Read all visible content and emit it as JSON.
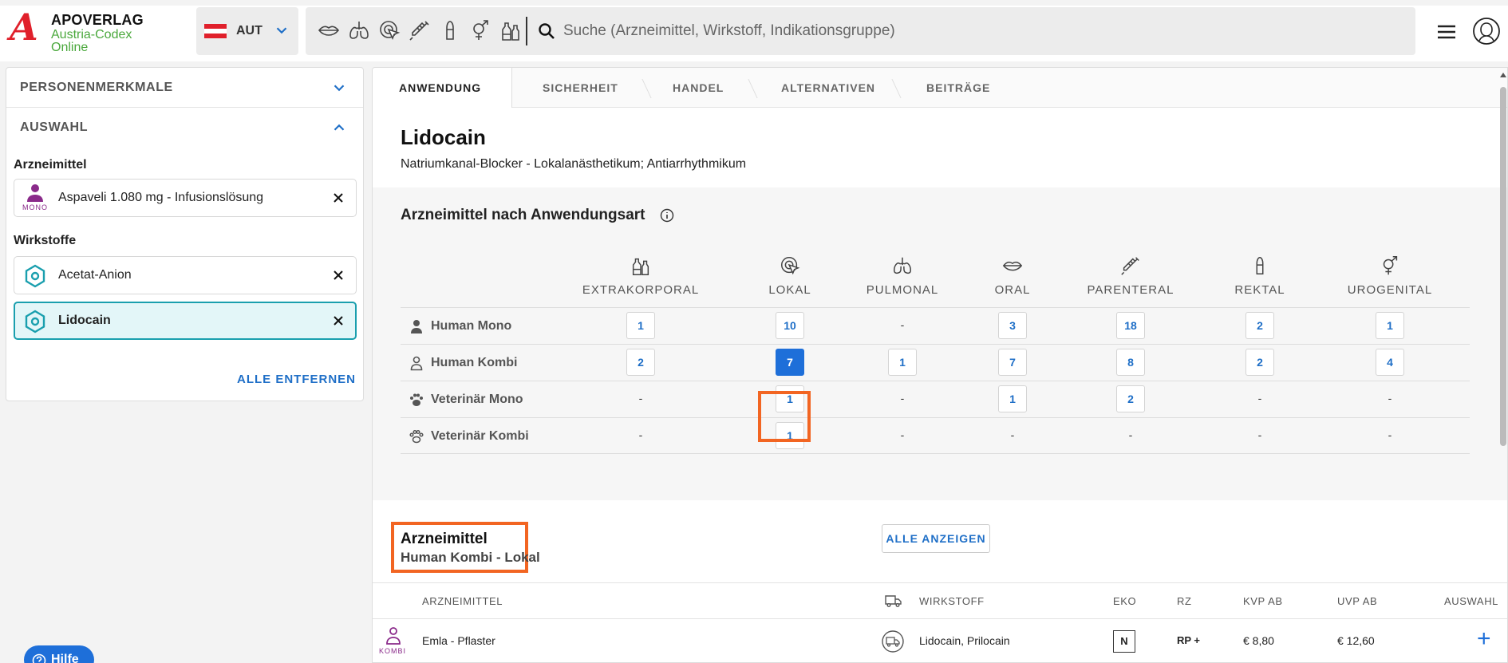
{
  "header": {
    "logo_title": "APOVERLAG",
    "logo_sub1": "Austria-Codex",
    "logo_sub2": "Online",
    "country_code": "AUT",
    "search_placeholder": "Suche (Arzneimittel, Wirkstoff, Indikationsgruppe)"
  },
  "sidebar": {
    "accordion_personen": "PERSONENMERKMALE",
    "accordion_auswahl": "AUSWAHL",
    "section_arzneimittel": "Arzneimittel",
    "drug_chip": "Aspaveli 1.080 mg - Infusionslösung",
    "drug_chip_tag": "MONO",
    "section_wirkstoffe": "Wirkstoffe",
    "substances": [
      "Acetat-Anion",
      "Lidocain"
    ],
    "remove_all": "ALLE ENTFERNEN"
  },
  "tabs": [
    "ANWENDUNG",
    "SICHERHEIT",
    "HANDEL",
    "ALTERNATIVEN",
    "BEITRÄGE"
  ],
  "main": {
    "title": "Lidocain",
    "subtitle": "Natriumkanal-Blocker - Lokalanästhetikum; Antiarrhythmikum",
    "usage_title": "Arzneimittel nach Anwendungsart",
    "columns": [
      "EXTRAKORPORAL",
      "LOKAL",
      "PULMONAL",
      "ORAL",
      "PARENTERAL",
      "REKTAL",
      "UROGENITAL"
    ],
    "rows": [
      {
        "label": "Human Mono",
        "values": [
          "1",
          "10",
          "-",
          "3",
          "18",
          "2",
          "1"
        ]
      },
      {
        "label": "Human Kombi",
        "values": [
          "2",
          "7",
          "1",
          "7",
          "8",
          "2",
          "4"
        ]
      },
      {
        "label": "Veterinär Mono",
        "values": [
          "-",
          "1",
          "-",
          "1",
          "2",
          "-",
          "-"
        ]
      },
      {
        "label": "Veterinär Kombi",
        "values": [
          "-",
          "1",
          "-",
          "-",
          "-",
          "-",
          "-"
        ]
      }
    ],
    "show_all": "ALLE ANZEIGEN",
    "list_title": "Arzneimittel",
    "list_subtitle": "Human Kombi - Lokal"
  },
  "table": {
    "headers": [
      "ARZNEIMITTEL",
      "WIRKSTOFF",
      "EKO",
      "RZ",
      "KVP AB",
      "UVP AB",
      "AUSWAHL"
    ],
    "rows": [
      {
        "tag": "KOMBI",
        "name": "Emla - Pflaster",
        "substance": "Lidocain, Prilocain",
        "eko": "N",
        "rz": "RP +",
        "kvp": "€ 8,80",
        "uvp": "€ 12,60"
      }
    ]
  },
  "help": "Hilfe",
  "colors": {
    "accent": "#1e6fd9",
    "highlight": "#f26522",
    "teal": "#1a9fae",
    "brand_red": "#e0202b",
    "brand_green": "#4aa83c"
  }
}
